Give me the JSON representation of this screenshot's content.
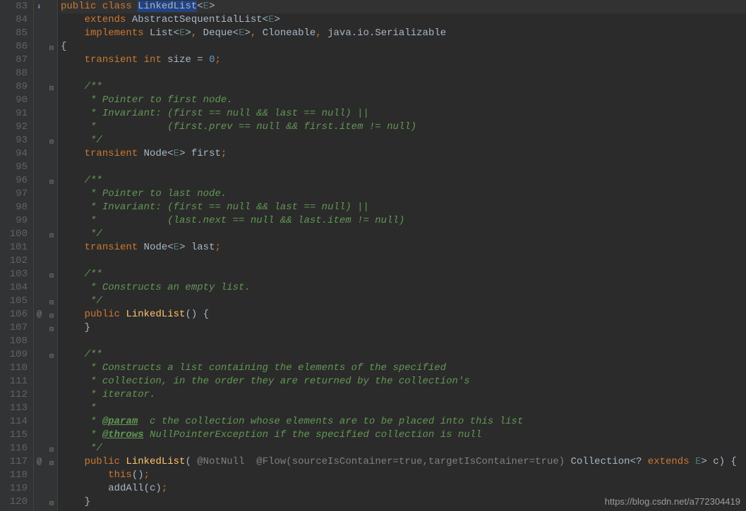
{
  "watermark": "https://blog.csdn.net/a772304419",
  "lines": [
    {
      "n": 83,
      "ann": "search",
      "fold": "",
      "code": [
        {
          "cls": "kw",
          "t": "public"
        },
        {
          "cls": "",
          "t": " "
        },
        {
          "cls": "kw",
          "t": "class"
        },
        {
          "cls": "",
          "t": " "
        },
        {
          "cls": "hl",
          "t": "LinkedList"
        },
        {
          "cls": "",
          "t": "<"
        },
        {
          "cls": "gen",
          "t": "E"
        },
        {
          "cls": "",
          "t": ">"
        }
      ]
    },
    {
      "n": 84,
      "ann": "",
      "fold": "",
      "code": [
        {
          "cls": "",
          "t": "    "
        },
        {
          "cls": "kw",
          "t": "extends"
        },
        {
          "cls": "",
          "t": " AbstractSequentialList<"
        },
        {
          "cls": "gen",
          "t": "E"
        },
        {
          "cls": "",
          "t": ">"
        }
      ]
    },
    {
      "n": 85,
      "ann": "",
      "fold": "",
      "code": [
        {
          "cls": "",
          "t": "    "
        },
        {
          "cls": "kw",
          "t": "implements"
        },
        {
          "cls": "",
          "t": " List<"
        },
        {
          "cls": "gen",
          "t": "E"
        },
        {
          "cls": "",
          "t": ">"
        },
        {
          "cls": "punct",
          "t": ","
        },
        {
          "cls": "",
          "t": " Deque<"
        },
        {
          "cls": "gen",
          "t": "E"
        },
        {
          "cls": "",
          "t": ">"
        },
        {
          "cls": "punct",
          "t": ","
        },
        {
          "cls": "",
          "t": " Cloneable"
        },
        {
          "cls": "punct",
          "t": ","
        },
        {
          "cls": "",
          "t": " java.io.Serializable"
        }
      ]
    },
    {
      "n": 86,
      "ann": "",
      "fold": "open",
      "code": [
        {
          "cls": "",
          "t": "{"
        }
      ]
    },
    {
      "n": 87,
      "ann": "",
      "fold": "",
      "code": [
        {
          "cls": "",
          "t": "    "
        },
        {
          "cls": "kw",
          "t": "transient"
        },
        {
          "cls": "",
          "t": " "
        },
        {
          "cls": "kw",
          "t": "int"
        },
        {
          "cls": "",
          "t": " size = "
        },
        {
          "cls": "num",
          "t": "0"
        },
        {
          "cls": "punct",
          "t": ";"
        }
      ]
    },
    {
      "n": 88,
      "ann": "",
      "fold": "",
      "code": [
        {
          "cls": "",
          "t": ""
        }
      ]
    },
    {
      "n": 89,
      "ann": "",
      "fold": "open",
      "code": [
        {
          "cls": "",
          "t": "    "
        },
        {
          "cls": "cmt",
          "t": "/**"
        }
      ]
    },
    {
      "n": 90,
      "ann": "",
      "fold": "",
      "code": [
        {
          "cls": "",
          "t": "    "
        },
        {
          "cls": "cmt",
          "t": " * Pointer to first node."
        }
      ]
    },
    {
      "n": 91,
      "ann": "",
      "fold": "",
      "code": [
        {
          "cls": "",
          "t": "    "
        },
        {
          "cls": "cmt",
          "t": " * Invariant: (first == null && last == null) ||"
        }
      ]
    },
    {
      "n": 92,
      "ann": "",
      "fold": "",
      "code": [
        {
          "cls": "",
          "t": "    "
        },
        {
          "cls": "cmt",
          "t": " *            (first.prev == null && first.item != null)"
        }
      ]
    },
    {
      "n": 93,
      "ann": "",
      "fold": "close",
      "code": [
        {
          "cls": "",
          "t": "    "
        },
        {
          "cls": "cmt",
          "t": " */"
        }
      ]
    },
    {
      "n": 94,
      "ann": "",
      "fold": "",
      "code": [
        {
          "cls": "",
          "t": "    "
        },
        {
          "cls": "kw",
          "t": "transient"
        },
        {
          "cls": "",
          "t": " Node<"
        },
        {
          "cls": "gen",
          "t": "E"
        },
        {
          "cls": "",
          "t": "> first"
        },
        {
          "cls": "punct",
          "t": ";"
        }
      ]
    },
    {
      "n": 95,
      "ann": "",
      "fold": "",
      "code": [
        {
          "cls": "",
          "t": ""
        }
      ]
    },
    {
      "n": 96,
      "ann": "",
      "fold": "open",
      "code": [
        {
          "cls": "",
          "t": "    "
        },
        {
          "cls": "cmt",
          "t": "/**"
        }
      ]
    },
    {
      "n": 97,
      "ann": "",
      "fold": "",
      "code": [
        {
          "cls": "",
          "t": "    "
        },
        {
          "cls": "cmt",
          "t": " * Pointer to last node."
        }
      ]
    },
    {
      "n": 98,
      "ann": "",
      "fold": "",
      "code": [
        {
          "cls": "",
          "t": "    "
        },
        {
          "cls": "cmt",
          "t": " * Invariant: (first == null && last == null) ||"
        }
      ]
    },
    {
      "n": 99,
      "ann": "",
      "fold": "",
      "code": [
        {
          "cls": "",
          "t": "    "
        },
        {
          "cls": "cmt",
          "t": " *            (last.next == null && last.item != null)"
        }
      ]
    },
    {
      "n": 100,
      "ann": "",
      "fold": "close",
      "code": [
        {
          "cls": "",
          "t": "    "
        },
        {
          "cls": "cmt",
          "t": " */"
        }
      ]
    },
    {
      "n": 101,
      "ann": "",
      "fold": "",
      "code": [
        {
          "cls": "",
          "t": "    "
        },
        {
          "cls": "kw",
          "t": "transient"
        },
        {
          "cls": "",
          "t": " Node<"
        },
        {
          "cls": "gen",
          "t": "E"
        },
        {
          "cls": "",
          "t": "> last"
        },
        {
          "cls": "punct",
          "t": ";"
        }
      ]
    },
    {
      "n": 102,
      "ann": "",
      "fold": "",
      "code": [
        {
          "cls": "",
          "t": ""
        }
      ]
    },
    {
      "n": 103,
      "ann": "",
      "fold": "open",
      "code": [
        {
          "cls": "",
          "t": "    "
        },
        {
          "cls": "cmt",
          "t": "/**"
        }
      ]
    },
    {
      "n": 104,
      "ann": "",
      "fold": "",
      "code": [
        {
          "cls": "",
          "t": "    "
        },
        {
          "cls": "cmt",
          "t": " * Constructs an empty list."
        }
      ]
    },
    {
      "n": 105,
      "ann": "",
      "fold": "close",
      "code": [
        {
          "cls": "",
          "t": "    "
        },
        {
          "cls": "cmt",
          "t": " */"
        }
      ]
    },
    {
      "n": 106,
      "ann": "@",
      "fold": "open",
      "code": [
        {
          "cls": "",
          "t": "    "
        },
        {
          "cls": "kw",
          "t": "public"
        },
        {
          "cls": "",
          "t": " "
        },
        {
          "cls": "ident",
          "t": "LinkedList"
        },
        {
          "cls": "",
          "t": "() {"
        }
      ]
    },
    {
      "n": 107,
      "ann": "",
      "fold": "close",
      "code": [
        {
          "cls": "",
          "t": "    }"
        }
      ]
    },
    {
      "n": 108,
      "ann": "",
      "fold": "",
      "code": [
        {
          "cls": "",
          "t": ""
        }
      ]
    },
    {
      "n": 109,
      "ann": "",
      "fold": "open",
      "code": [
        {
          "cls": "",
          "t": "    "
        },
        {
          "cls": "cmt",
          "t": "/**"
        }
      ]
    },
    {
      "n": 110,
      "ann": "",
      "fold": "",
      "code": [
        {
          "cls": "",
          "t": "    "
        },
        {
          "cls": "cmt",
          "t": " * Constructs a list containing the elements of the specified"
        }
      ]
    },
    {
      "n": 111,
      "ann": "",
      "fold": "",
      "code": [
        {
          "cls": "",
          "t": "    "
        },
        {
          "cls": "cmt",
          "t": " * collection, in the order they are returned by the collection's"
        }
      ]
    },
    {
      "n": 112,
      "ann": "",
      "fold": "",
      "code": [
        {
          "cls": "",
          "t": "    "
        },
        {
          "cls": "cmt",
          "t": " * iterator."
        }
      ]
    },
    {
      "n": 113,
      "ann": "",
      "fold": "",
      "code": [
        {
          "cls": "",
          "t": "    "
        },
        {
          "cls": "cmt",
          "t": " *"
        }
      ]
    },
    {
      "n": 114,
      "ann": "",
      "fold": "",
      "code": [
        {
          "cls": "",
          "t": "    "
        },
        {
          "cls": "cmt",
          "t": " * "
        },
        {
          "cls": "cmt-tag",
          "t": "@param"
        },
        {
          "cls": "cmt",
          "t": "  c the collection whose elements are to be placed into this list"
        }
      ]
    },
    {
      "n": 115,
      "ann": "",
      "fold": "",
      "code": [
        {
          "cls": "",
          "t": "    "
        },
        {
          "cls": "cmt",
          "t": " * "
        },
        {
          "cls": "cmt-tag",
          "t": "@throws"
        },
        {
          "cls": "cmt",
          "t": " NullPointerException if the specified collection is null"
        }
      ]
    },
    {
      "n": 116,
      "ann": "",
      "fold": "close",
      "code": [
        {
          "cls": "",
          "t": "    "
        },
        {
          "cls": "cmt",
          "t": " */"
        }
      ]
    },
    {
      "n": 117,
      "ann": "@",
      "fold": "open",
      "code": [
        {
          "cls": "",
          "t": "    "
        },
        {
          "cls": "kw",
          "t": "public"
        },
        {
          "cls": "",
          "t": " "
        },
        {
          "cls": "ident",
          "t": "LinkedList"
        },
        {
          "cls": "",
          "t": "( "
        },
        {
          "cls": "ann",
          "t": "@NotNull"
        },
        {
          "cls": "",
          "t": "  "
        },
        {
          "cls": "ann",
          "t": "@Flow(sourceIsContainer=true,targetIsContainer=true)"
        },
        {
          "cls": "",
          "t": " Collection<? "
        },
        {
          "cls": "kw",
          "t": "extends"
        },
        {
          "cls": "",
          "t": " "
        },
        {
          "cls": "gen",
          "t": "E"
        },
        {
          "cls": "",
          "t": "> c) {"
        }
      ]
    },
    {
      "n": 118,
      "ann": "",
      "fold": "",
      "code": [
        {
          "cls": "",
          "t": "        "
        },
        {
          "cls": "kw",
          "t": "this"
        },
        {
          "cls": "",
          "t": "()"
        },
        {
          "cls": "punct",
          "t": ";"
        }
      ]
    },
    {
      "n": 119,
      "ann": "",
      "fold": "",
      "code": [
        {
          "cls": "",
          "t": "        addAll(c)"
        },
        {
          "cls": "punct",
          "t": ";"
        }
      ]
    },
    {
      "n": 120,
      "ann": "",
      "fold": "close",
      "code": [
        {
          "cls": "",
          "t": "    }"
        }
      ]
    }
  ]
}
